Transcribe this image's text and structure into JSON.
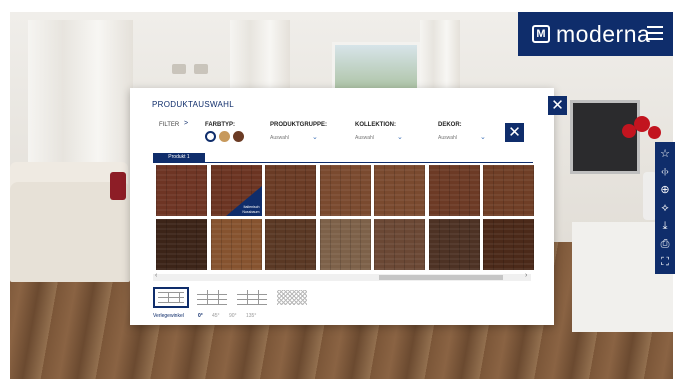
{
  "brand": {
    "name": "moderna",
    "logo_letter": "M"
  },
  "modal": {
    "title": "PRODUKTAUSWAHL",
    "filter_label": "FILTER",
    "filter_chevron": ">",
    "filters": [
      {
        "label": "FARBTYP:",
        "value": ""
      },
      {
        "label": "PRODUKTGRUPPE:",
        "value": "Auswahl"
      },
      {
        "label": "KOLLEKTION:",
        "value": "Auswahl"
      },
      {
        "label": "DEKOR:",
        "value": "Auswahl"
      }
    ],
    "color_swatches": [
      "#ffffff",
      "#c7995c",
      "#6b3b24"
    ],
    "product_tab": "Produkt 1",
    "badge_text": "Italienisch Nussbaum",
    "tiles": [
      "#6e3524",
      "#6b3422",
      "#6a3b25",
      "#7a4a2f",
      "#7a4a2f",
      "#6c3a25",
      "#6f3e26",
      "#3c2418",
      "#86532f",
      "#5a3824",
      "#7d6149",
      "#6b4835",
      "#4d3224",
      "#4b2919"
    ],
    "angle_label": "Verlegewinkel",
    "angles": [
      "0°",
      "45°",
      "90°",
      "135°"
    ],
    "scroll_left": "‹",
    "scroll_right": "›"
  },
  "toolbar": {
    "icons": [
      "star-icon",
      "compare-icon",
      "zoom-icon",
      "link-icon",
      "download-icon",
      "print-icon",
      "fullscreen-icon"
    ],
    "glyphs": [
      "☆",
      "‹|›",
      "⊕",
      "⟡",
      "⤓",
      "⎙",
      "⛶"
    ]
  }
}
